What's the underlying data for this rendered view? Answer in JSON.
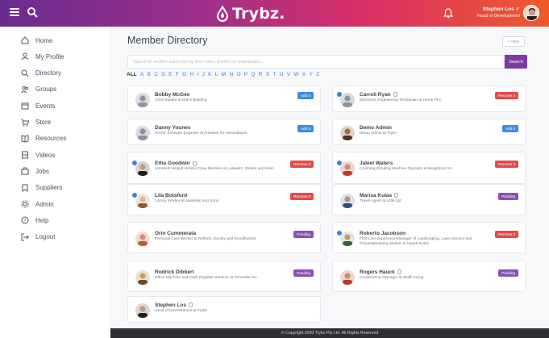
{
  "topbar": {
    "logo": "Trybz.",
    "user_name": "Stephen Los ✓",
    "user_role": "Head of Development"
  },
  "sidebar": {
    "items": [
      {
        "label": "Home",
        "icon": "home-icon"
      },
      {
        "label": "My Profile",
        "icon": "user-icon"
      },
      {
        "label": "Directory",
        "icon": "search-icon"
      },
      {
        "label": "Groups",
        "icon": "users-icon"
      },
      {
        "label": "Events",
        "icon": "calendar-icon"
      },
      {
        "label": "Store",
        "icon": "cart-icon"
      },
      {
        "label": "Resources",
        "icon": "book-icon"
      },
      {
        "label": "Videos",
        "icon": "film-icon"
      },
      {
        "label": "Jobs",
        "icon": "briefcase-icon"
      },
      {
        "label": "Suppliers",
        "icon": "bookmark-icon"
      },
      {
        "label": "Admin",
        "icon": "gear-icon"
      },
      {
        "label": "Help",
        "icon": "help-icon"
      },
      {
        "label": "Logout",
        "icon": "logout-icon"
      }
    ]
  },
  "main": {
    "title": "Member Directory",
    "new_label": "+ New",
    "search_placeholder": "Search for another subscriber by their name, position or organisation...",
    "search_button": "Search",
    "alphabet": [
      "ALL",
      "A",
      "B",
      "C",
      "D",
      "E",
      "F",
      "G",
      "H",
      "I",
      "J",
      "K",
      "L",
      "M",
      "N",
      "O",
      "P",
      "Q",
      "R",
      "S",
      "T",
      "U",
      "V",
      "W",
      "X",
      "Y",
      "Z"
    ]
  },
  "members": [
    {
      "name": "Bobby McGee",
      "subtitle": "Chief Builder at Bob's Building",
      "action": "Add It",
      "kind": "add",
      "verified": false,
      "checked": false,
      "avatar": "placeholder"
    },
    {
      "name": "Carroll Ryan",
      "subtitle": "Electronic Engineering Technician at Herse PLC",
      "action": "Remove It",
      "kind": "remove",
      "verified": true,
      "checked": true,
      "avatar": "placeholder"
    },
    {
      "name": "Danny Younes",
      "subtitle": "Senior Software Engineer at Answers for Associations",
      "action": "Add It",
      "kind": "add",
      "verified": false,
      "checked": false,
      "avatar": "placeholder"
    },
    {
      "name": "Demo Admin",
      "subtitle": "Demo Admin at Trybz",
      "action": "Add It",
      "kind": "add",
      "verified": false,
      "checked": false,
      "avatar": "photo-brown"
    },
    {
      "name": "Etha Goodwin",
      "subtitle": "Armored Assault Vehicle Crew Member at Lubowitz, Stokes and Klein",
      "action": "Remove It",
      "kind": "remove",
      "verified": true,
      "checked": true,
      "avatar": "photo-dark"
    },
    {
      "name": "Jaleel Waters",
      "subtitle": "Crushing Grinding Machine Operator at Bergstrom Inc",
      "action": "Remove It",
      "kind": "remove",
      "verified": false,
      "checked": true,
      "avatar": "photo-red"
    },
    {
      "name": "Lila Botsford",
      "subtitle": "Library Worker at Jaskolski and Sons",
      "action": "Remove It",
      "kind": "remove",
      "verified": false,
      "checked": true,
      "avatar": "photo-light"
    },
    {
      "name": "Marisa Kulas",
      "subtitle": "Travel Agent at Little Ltd",
      "action": "Pending",
      "kind": "pending",
      "verified": true,
      "checked": false,
      "avatar": "photo-blue"
    },
    {
      "name": "Orin Cummerata",
      "subtitle": "Personal Care Worker at Rolfson, Dooley and Runolfsdottir",
      "action": "Pending",
      "kind": "pending",
      "verified": false,
      "checked": false,
      "avatar": "photo-orange"
    },
    {
      "name": "Roberto Jacobson",
      "subtitle": "First-Line Supervisor-Manager of Landscaping, Lawn Service and Groundskeeping Worker at Hauck-Kutch",
      "action": "Remove It",
      "kind": "remove",
      "verified": false,
      "checked": true,
      "avatar": "photo-green"
    },
    {
      "name": "Rodrick Dibbert",
      "subtitle": "Office Machine and Cash Register Servicer at Schmeler-Inc",
      "action": "Pending",
      "kind": "pending",
      "verified": false,
      "checked": false,
      "avatar": "photo-tan"
    },
    {
      "name": "Rogers Hauck",
      "subtitle": "Construction Manager at Wolff Group",
      "action": "Pending",
      "kind": "pending",
      "verified": true,
      "checked": false,
      "avatar": "photo-red"
    },
    {
      "name": "Stephen Los",
      "subtitle": "Head of Development at Trybz",
      "action": "",
      "kind": "none",
      "verified": true,
      "checked": false,
      "avatar": "photo-dark"
    }
  ],
  "footer": {
    "text": "© Copyright 2020 Trybz Pty Ltd. All Rights Reserved"
  },
  "colors": {
    "brand_start": "#6a2c91",
    "brand_end": "#f05a2a",
    "add": "#3b8be6",
    "remove": "#e24b4b",
    "pending": "#8a4fb6"
  }
}
